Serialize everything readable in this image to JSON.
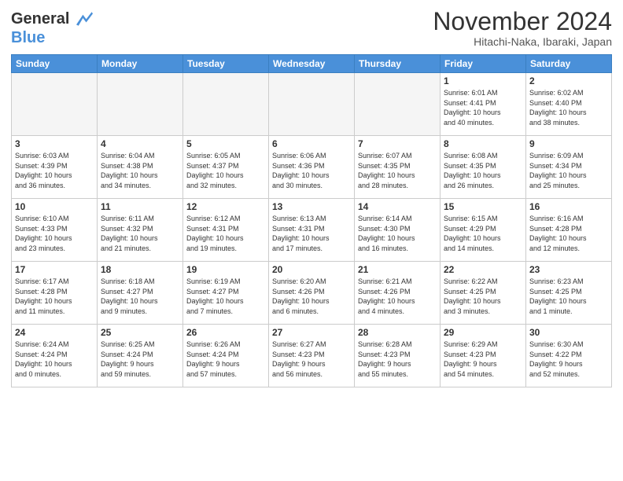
{
  "logo": {
    "line1": "General",
    "line2": "Blue"
  },
  "header": {
    "title": "November 2024",
    "subtitle": "Hitachi-Naka, Ibaraki, Japan"
  },
  "weekdays": [
    "Sunday",
    "Monday",
    "Tuesday",
    "Wednesday",
    "Thursday",
    "Friday",
    "Saturday"
  ],
  "weeks": [
    [
      {
        "day": "",
        "info": ""
      },
      {
        "day": "",
        "info": ""
      },
      {
        "day": "",
        "info": ""
      },
      {
        "day": "",
        "info": ""
      },
      {
        "day": "",
        "info": ""
      },
      {
        "day": "1",
        "info": "Sunrise: 6:01 AM\nSunset: 4:41 PM\nDaylight: 10 hours\nand 40 minutes."
      },
      {
        "day": "2",
        "info": "Sunrise: 6:02 AM\nSunset: 4:40 PM\nDaylight: 10 hours\nand 38 minutes."
      }
    ],
    [
      {
        "day": "3",
        "info": "Sunrise: 6:03 AM\nSunset: 4:39 PM\nDaylight: 10 hours\nand 36 minutes."
      },
      {
        "day": "4",
        "info": "Sunrise: 6:04 AM\nSunset: 4:38 PM\nDaylight: 10 hours\nand 34 minutes."
      },
      {
        "day": "5",
        "info": "Sunrise: 6:05 AM\nSunset: 4:37 PM\nDaylight: 10 hours\nand 32 minutes."
      },
      {
        "day": "6",
        "info": "Sunrise: 6:06 AM\nSunset: 4:36 PM\nDaylight: 10 hours\nand 30 minutes."
      },
      {
        "day": "7",
        "info": "Sunrise: 6:07 AM\nSunset: 4:35 PM\nDaylight: 10 hours\nand 28 minutes."
      },
      {
        "day": "8",
        "info": "Sunrise: 6:08 AM\nSunset: 4:35 PM\nDaylight: 10 hours\nand 26 minutes."
      },
      {
        "day": "9",
        "info": "Sunrise: 6:09 AM\nSunset: 4:34 PM\nDaylight: 10 hours\nand 25 minutes."
      }
    ],
    [
      {
        "day": "10",
        "info": "Sunrise: 6:10 AM\nSunset: 4:33 PM\nDaylight: 10 hours\nand 23 minutes."
      },
      {
        "day": "11",
        "info": "Sunrise: 6:11 AM\nSunset: 4:32 PM\nDaylight: 10 hours\nand 21 minutes."
      },
      {
        "day": "12",
        "info": "Sunrise: 6:12 AM\nSunset: 4:31 PM\nDaylight: 10 hours\nand 19 minutes."
      },
      {
        "day": "13",
        "info": "Sunrise: 6:13 AM\nSunset: 4:31 PM\nDaylight: 10 hours\nand 17 minutes."
      },
      {
        "day": "14",
        "info": "Sunrise: 6:14 AM\nSunset: 4:30 PM\nDaylight: 10 hours\nand 16 minutes."
      },
      {
        "day": "15",
        "info": "Sunrise: 6:15 AM\nSunset: 4:29 PM\nDaylight: 10 hours\nand 14 minutes."
      },
      {
        "day": "16",
        "info": "Sunrise: 6:16 AM\nSunset: 4:28 PM\nDaylight: 10 hours\nand 12 minutes."
      }
    ],
    [
      {
        "day": "17",
        "info": "Sunrise: 6:17 AM\nSunset: 4:28 PM\nDaylight: 10 hours\nand 11 minutes."
      },
      {
        "day": "18",
        "info": "Sunrise: 6:18 AM\nSunset: 4:27 PM\nDaylight: 10 hours\nand 9 minutes."
      },
      {
        "day": "19",
        "info": "Sunrise: 6:19 AM\nSunset: 4:27 PM\nDaylight: 10 hours\nand 7 minutes."
      },
      {
        "day": "20",
        "info": "Sunrise: 6:20 AM\nSunset: 4:26 PM\nDaylight: 10 hours\nand 6 minutes."
      },
      {
        "day": "21",
        "info": "Sunrise: 6:21 AM\nSunset: 4:26 PM\nDaylight: 10 hours\nand 4 minutes."
      },
      {
        "day": "22",
        "info": "Sunrise: 6:22 AM\nSunset: 4:25 PM\nDaylight: 10 hours\nand 3 minutes."
      },
      {
        "day": "23",
        "info": "Sunrise: 6:23 AM\nSunset: 4:25 PM\nDaylight: 10 hours\nand 1 minute."
      }
    ],
    [
      {
        "day": "24",
        "info": "Sunrise: 6:24 AM\nSunset: 4:24 PM\nDaylight: 10 hours\nand 0 minutes."
      },
      {
        "day": "25",
        "info": "Sunrise: 6:25 AM\nSunset: 4:24 PM\nDaylight: 9 hours\nand 59 minutes."
      },
      {
        "day": "26",
        "info": "Sunrise: 6:26 AM\nSunset: 4:24 PM\nDaylight: 9 hours\nand 57 minutes."
      },
      {
        "day": "27",
        "info": "Sunrise: 6:27 AM\nSunset: 4:23 PM\nDaylight: 9 hours\nand 56 minutes."
      },
      {
        "day": "28",
        "info": "Sunrise: 6:28 AM\nSunset: 4:23 PM\nDaylight: 9 hours\nand 55 minutes."
      },
      {
        "day": "29",
        "info": "Sunrise: 6:29 AM\nSunset: 4:23 PM\nDaylight: 9 hours\nand 54 minutes."
      },
      {
        "day": "30",
        "info": "Sunrise: 6:30 AM\nSunset: 4:22 PM\nDaylight: 9 hours\nand 52 minutes."
      }
    ]
  ]
}
